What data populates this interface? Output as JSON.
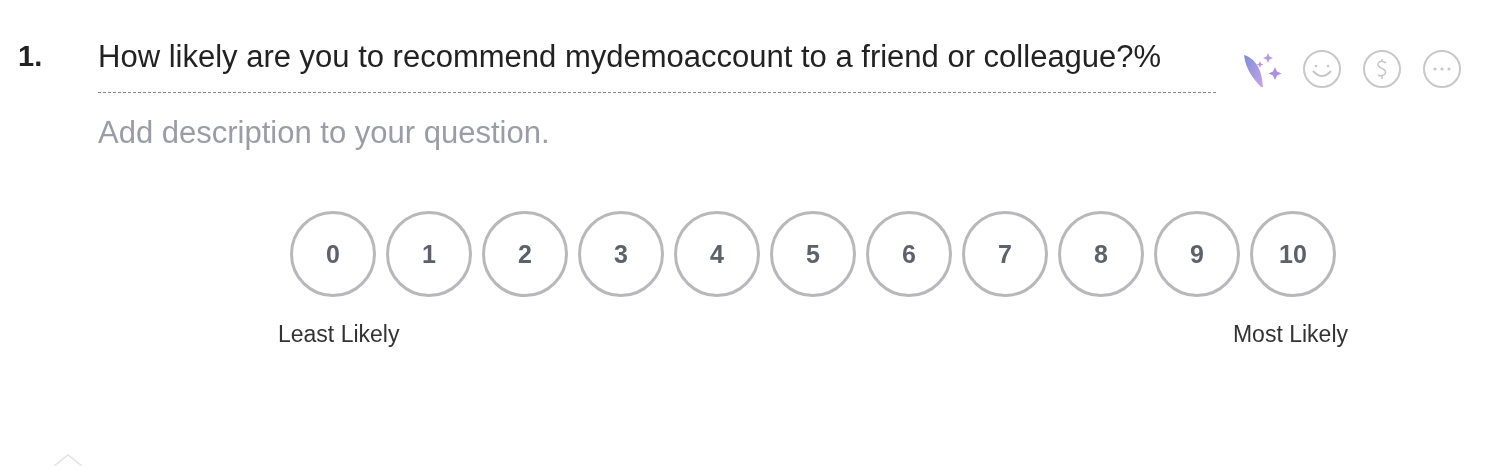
{
  "question": {
    "number": "1.",
    "title": "How likely are you to recommend mydemoaccount to a friend or colleague?%",
    "description_placeholder": "Add description to your question."
  },
  "toolbar": [
    {
      "kind": "ai"
    },
    {
      "kind": "smiley"
    },
    {
      "kind": "dollar"
    },
    {
      "kind": "more"
    }
  ],
  "scale": {
    "options": [
      {
        "label": "0",
        "selected": false
      },
      {
        "label": "1",
        "selected": false
      },
      {
        "label": "2",
        "selected": false
      },
      {
        "label": "3",
        "selected": false
      },
      {
        "label": "4",
        "selected": false
      },
      {
        "label": "5",
        "selected": false
      },
      {
        "label": "6",
        "selected": false
      },
      {
        "label": "7",
        "selected": false
      },
      {
        "label": "8",
        "selected": false
      },
      {
        "label": "9",
        "selected": false
      },
      {
        "label": "10",
        "selected": false
      }
    ],
    "min_label": "Least Likely",
    "max_label": "Most Likely"
  }
}
